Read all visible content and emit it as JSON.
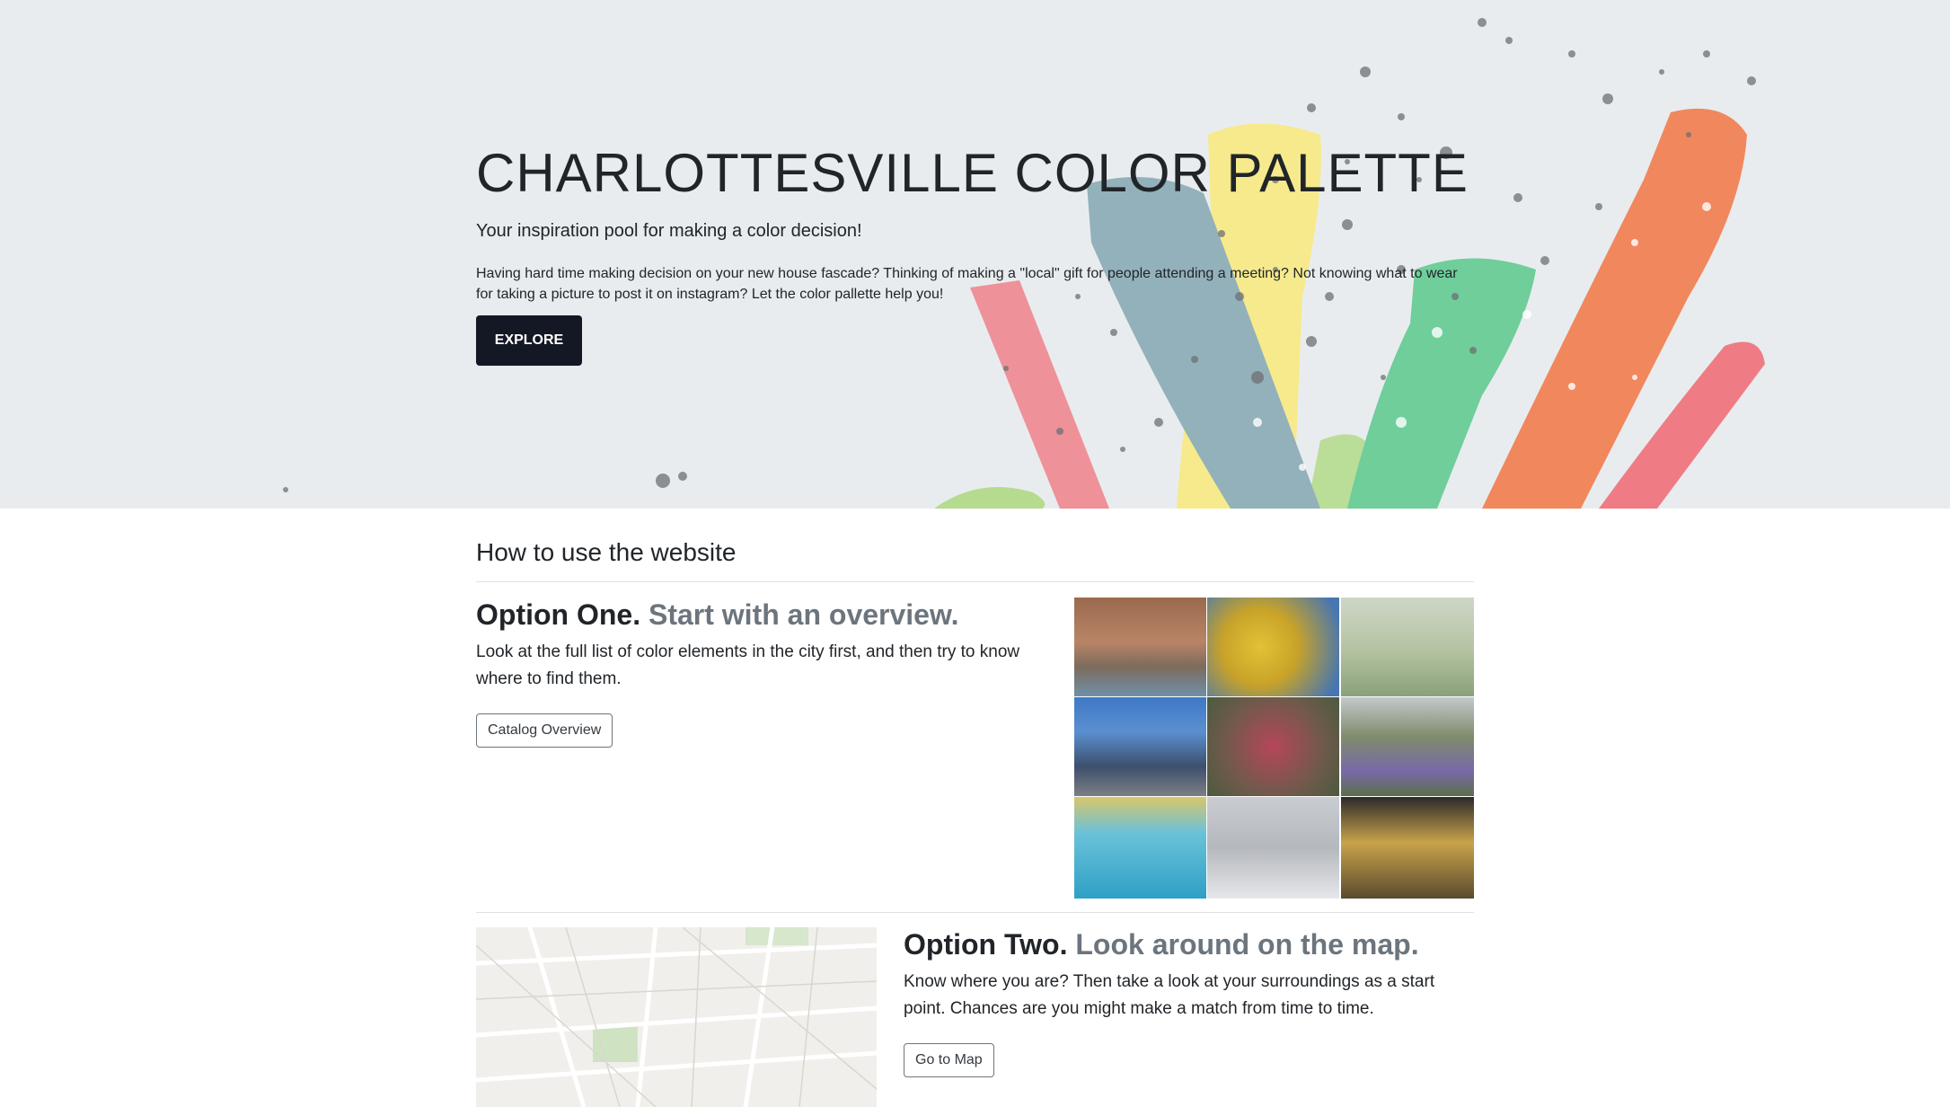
{
  "hero": {
    "title": "CHARLOTTESVILLE COLOR PALETTE",
    "lead": "Your inspiration pool for making a color decision!",
    "text": "Having hard time making decision on your new house fascade? Thinking of making a \"local\" gift for people attending a meeting? Not knowing what to wear for taking a picture to post it on instagram? Let the color pallette help you!",
    "button": "EXPLORE",
    "brush_colors": [
      "#ee8c92",
      "#93b1bb",
      "#f6ea8c",
      "#6fce9a",
      "#f1875d",
      "#ef7c84",
      "#b5db8e"
    ]
  },
  "section": {
    "heading": "How to use the website"
  },
  "option_one": {
    "label": "Option One.",
    "tagline": "Start with an overview.",
    "text": "Look at the full list of color elements in the city first, and then try to know where to find them.",
    "button": "Catalog Overview"
  },
  "option_two": {
    "label": "Option Two.",
    "tagline": "Look around on the map.",
    "text": "Know where you are? Then take a look at your surroundings as a start point. Chances are you might make a match from time to time.",
    "button": "Go to Map"
  }
}
